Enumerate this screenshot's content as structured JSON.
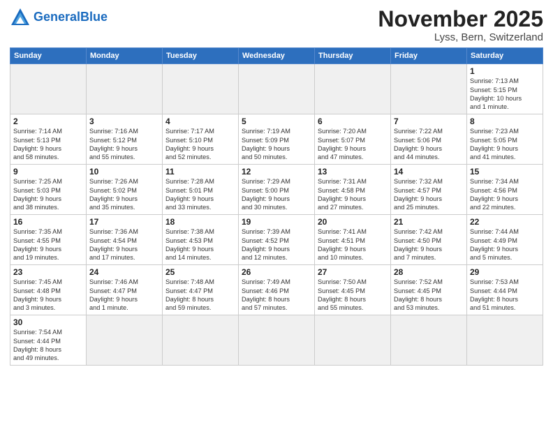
{
  "header": {
    "logo_general": "General",
    "logo_blue": "Blue",
    "month_title": "November 2025",
    "location": "Lyss, Bern, Switzerland"
  },
  "weekdays": [
    "Sunday",
    "Monday",
    "Tuesday",
    "Wednesday",
    "Thursday",
    "Friday",
    "Saturday"
  ],
  "weeks": [
    [
      {
        "day": "",
        "info": ""
      },
      {
        "day": "",
        "info": ""
      },
      {
        "day": "",
        "info": ""
      },
      {
        "day": "",
        "info": ""
      },
      {
        "day": "",
        "info": ""
      },
      {
        "day": "",
        "info": ""
      },
      {
        "day": "1",
        "info": "Sunrise: 7:13 AM\nSunset: 5:15 PM\nDaylight: 10 hours\nand 1 minute."
      }
    ],
    [
      {
        "day": "2",
        "info": "Sunrise: 7:14 AM\nSunset: 5:13 PM\nDaylight: 9 hours\nand 58 minutes."
      },
      {
        "day": "3",
        "info": "Sunrise: 7:16 AM\nSunset: 5:12 PM\nDaylight: 9 hours\nand 55 minutes."
      },
      {
        "day": "4",
        "info": "Sunrise: 7:17 AM\nSunset: 5:10 PM\nDaylight: 9 hours\nand 52 minutes."
      },
      {
        "day": "5",
        "info": "Sunrise: 7:19 AM\nSunset: 5:09 PM\nDaylight: 9 hours\nand 50 minutes."
      },
      {
        "day": "6",
        "info": "Sunrise: 7:20 AM\nSunset: 5:07 PM\nDaylight: 9 hours\nand 47 minutes."
      },
      {
        "day": "7",
        "info": "Sunrise: 7:22 AM\nSunset: 5:06 PM\nDaylight: 9 hours\nand 44 minutes."
      },
      {
        "day": "8",
        "info": "Sunrise: 7:23 AM\nSunset: 5:05 PM\nDaylight: 9 hours\nand 41 minutes."
      }
    ],
    [
      {
        "day": "9",
        "info": "Sunrise: 7:25 AM\nSunset: 5:03 PM\nDaylight: 9 hours\nand 38 minutes."
      },
      {
        "day": "10",
        "info": "Sunrise: 7:26 AM\nSunset: 5:02 PM\nDaylight: 9 hours\nand 35 minutes."
      },
      {
        "day": "11",
        "info": "Sunrise: 7:28 AM\nSunset: 5:01 PM\nDaylight: 9 hours\nand 33 minutes."
      },
      {
        "day": "12",
        "info": "Sunrise: 7:29 AM\nSunset: 5:00 PM\nDaylight: 9 hours\nand 30 minutes."
      },
      {
        "day": "13",
        "info": "Sunrise: 7:31 AM\nSunset: 4:58 PM\nDaylight: 9 hours\nand 27 minutes."
      },
      {
        "day": "14",
        "info": "Sunrise: 7:32 AM\nSunset: 4:57 PM\nDaylight: 9 hours\nand 25 minutes."
      },
      {
        "day": "15",
        "info": "Sunrise: 7:34 AM\nSunset: 4:56 PM\nDaylight: 9 hours\nand 22 minutes."
      }
    ],
    [
      {
        "day": "16",
        "info": "Sunrise: 7:35 AM\nSunset: 4:55 PM\nDaylight: 9 hours\nand 19 minutes."
      },
      {
        "day": "17",
        "info": "Sunrise: 7:36 AM\nSunset: 4:54 PM\nDaylight: 9 hours\nand 17 minutes."
      },
      {
        "day": "18",
        "info": "Sunrise: 7:38 AM\nSunset: 4:53 PM\nDaylight: 9 hours\nand 14 minutes."
      },
      {
        "day": "19",
        "info": "Sunrise: 7:39 AM\nSunset: 4:52 PM\nDaylight: 9 hours\nand 12 minutes."
      },
      {
        "day": "20",
        "info": "Sunrise: 7:41 AM\nSunset: 4:51 PM\nDaylight: 9 hours\nand 10 minutes."
      },
      {
        "day": "21",
        "info": "Sunrise: 7:42 AM\nSunset: 4:50 PM\nDaylight: 9 hours\nand 7 minutes."
      },
      {
        "day": "22",
        "info": "Sunrise: 7:44 AM\nSunset: 4:49 PM\nDaylight: 9 hours\nand 5 minutes."
      }
    ],
    [
      {
        "day": "23",
        "info": "Sunrise: 7:45 AM\nSunset: 4:48 PM\nDaylight: 9 hours\nand 3 minutes."
      },
      {
        "day": "24",
        "info": "Sunrise: 7:46 AM\nSunset: 4:47 PM\nDaylight: 9 hours\nand 1 minute."
      },
      {
        "day": "25",
        "info": "Sunrise: 7:48 AM\nSunset: 4:47 PM\nDaylight: 8 hours\nand 59 minutes."
      },
      {
        "day": "26",
        "info": "Sunrise: 7:49 AM\nSunset: 4:46 PM\nDaylight: 8 hours\nand 57 minutes."
      },
      {
        "day": "27",
        "info": "Sunrise: 7:50 AM\nSunset: 4:45 PM\nDaylight: 8 hours\nand 55 minutes."
      },
      {
        "day": "28",
        "info": "Sunrise: 7:52 AM\nSunset: 4:45 PM\nDaylight: 8 hours\nand 53 minutes."
      },
      {
        "day": "29",
        "info": "Sunrise: 7:53 AM\nSunset: 4:44 PM\nDaylight: 8 hours\nand 51 minutes."
      }
    ],
    [
      {
        "day": "30",
        "info": "Sunrise: 7:54 AM\nSunset: 4:44 PM\nDaylight: 8 hours\nand 49 minutes."
      },
      {
        "day": "",
        "info": ""
      },
      {
        "day": "",
        "info": ""
      },
      {
        "day": "",
        "info": ""
      },
      {
        "day": "",
        "info": ""
      },
      {
        "day": "",
        "info": ""
      },
      {
        "day": "",
        "info": ""
      }
    ]
  ]
}
